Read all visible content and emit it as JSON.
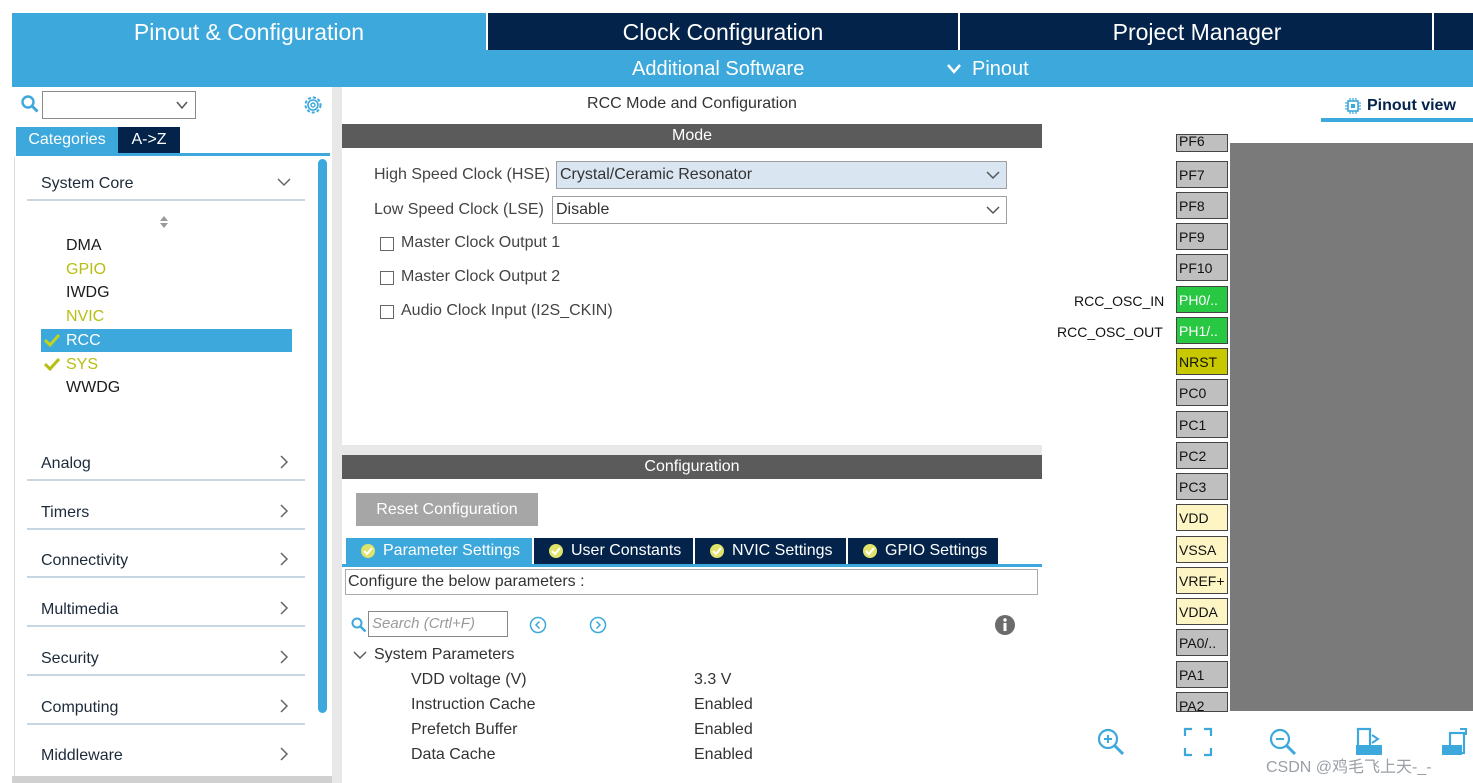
{
  "top_tabs": {
    "pinout": "Pinout & Configuration",
    "clock": "Clock Configuration",
    "project": "Project Manager"
  },
  "sub_bar": {
    "additional_software": "Additional Software",
    "pinout": "Pinout"
  },
  "left": {
    "search": {
      "value": ""
    },
    "tab_categories": "Categories",
    "tab_az": "A->Z",
    "groups": {
      "system_core": "System Core",
      "analog": "Analog",
      "timers": "Timers",
      "connectivity": "Connectivity",
      "multimedia": "Multimedia",
      "security": "Security",
      "computing": "Computing",
      "middleware": "Middleware"
    },
    "peripherals": {
      "dma": "DMA",
      "gpio": "GPIO",
      "iwdg": "IWDG",
      "nvic": "NVIC",
      "rcc": "RCC",
      "sys": "SYS",
      "wwdg": "WWDG"
    }
  },
  "mode": {
    "title": "RCC Mode and Configuration",
    "header": "Mode",
    "hse_label": "High Speed Clock (HSE)",
    "hse_value": "Crystal/Ceramic Resonator",
    "lse_label": "Low Speed Clock (LSE)",
    "lse_value": "Disable",
    "mco1": "Master Clock Output 1",
    "mco2": "Master Clock Output 2",
    "i2s_ckin": "Audio Clock Input (I2S_CKIN)"
  },
  "config": {
    "header": "Configuration",
    "reset": "Reset Configuration",
    "tabs": {
      "param": "Parameter Settings",
      "user": "User Constants",
      "nvic": "NVIC Settings",
      "gpio": "GPIO Settings"
    },
    "configure_text": "Configure the below parameters :",
    "search_placeholder": "Search (Crtl+F)",
    "section": "System Parameters",
    "params": {
      "vdd_label": "VDD voltage (V)",
      "vdd_value": "3.3 V",
      "icache_label": "Instruction Cache",
      "icache_value": "Enabled",
      "prefetch_label": "Prefetch Buffer",
      "prefetch_value": "Enabled",
      "dcache_label": "Data Cache",
      "dcache_value": "Enabled"
    }
  },
  "right": {
    "pinout_view": "Pinout view",
    "signal_osc_in": "RCC_OSC_IN",
    "signal_osc_out": "RCC_OSC_OUT",
    "pins": {
      "pf6": "PF6",
      "pf7": "PF7",
      "pf8": "PF8",
      "pf9": "PF9",
      "pf10": "PF10",
      "ph0": "PH0/..",
      "ph1": "PH1/..",
      "nrst": "NRST",
      "pc0": "PC0",
      "pc1": "PC1",
      "pc2": "PC2",
      "pc3": "PC3",
      "vdd": "VDD",
      "vssa": "VSSA",
      "vref": "VREF+",
      "vdda": "VDDA",
      "pa0": "PA0/..",
      "pa1": "PA1",
      "pa2": "PA2"
    }
  },
  "watermark": "CSDN @鸡毛飞上天-_-",
  "colors": {
    "navy": "#03234b",
    "accent": "#3ca8dc",
    "pin_green": "#29c843",
    "pin_olive": "#c8c800",
    "pin_power": "#fdf5c4"
  },
  "icons": [
    "search-icon",
    "chevron-down-icon",
    "gear-icon",
    "chevron-right-icon",
    "sort-icon",
    "check-icon",
    "info-icon",
    "prev-icon",
    "next-icon",
    "zoom-in-icon",
    "fit-icon",
    "zoom-out-icon",
    "export-icon",
    "rotate-icon"
  ]
}
